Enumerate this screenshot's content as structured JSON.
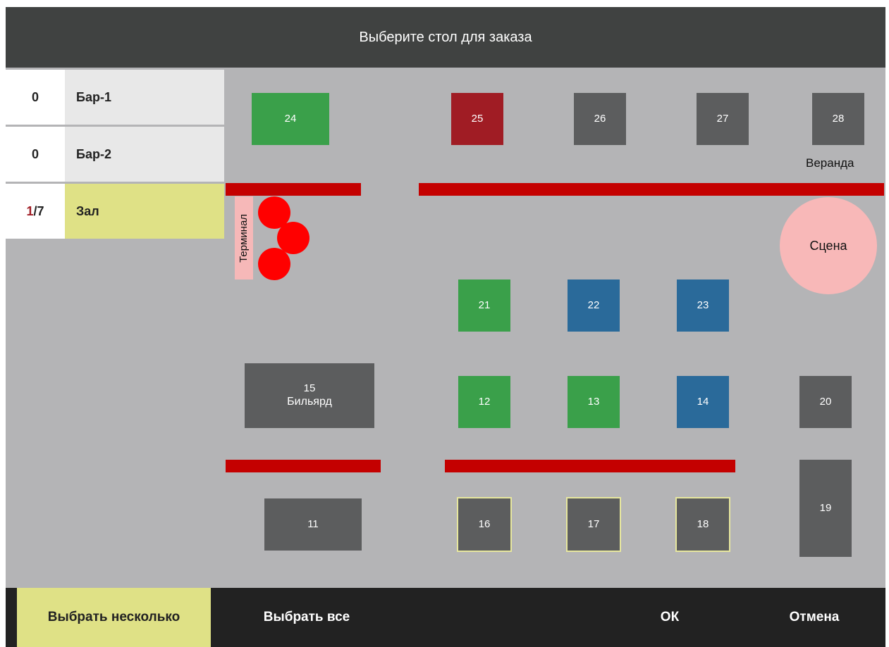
{
  "header": {
    "title": "Выберите стол для заказа"
  },
  "rooms": [
    {
      "count": "0",
      "name": "Бар-1"
    },
    {
      "count": "0",
      "name": "Бар-2"
    },
    {
      "count_highlight": "1",
      "count_rest": "/7",
      "name": "Зал"
    }
  ],
  "tables": {
    "t24": "24",
    "t25": "25",
    "t26": "26",
    "t27": "27",
    "t28": "28",
    "t21": "21",
    "t22": "22",
    "t23": "23",
    "t15": "15",
    "t15_sub": "Бильярд",
    "t12": "12",
    "t13": "13",
    "t14": "14",
    "t20": "20",
    "t11": "11",
    "t16": "16",
    "t17": "17",
    "t18": "18",
    "t19": "19"
  },
  "labels": {
    "veranda": "Веранда",
    "terminal": "Терминал",
    "stage": "Сцена"
  },
  "footer": {
    "select_multiple": "Выбрать несколько",
    "select_all": "Выбрать все",
    "ok": "ОК",
    "cancel": "Отмена"
  },
  "colors": {
    "free": "#5c5d5e",
    "occupied_green": "#3aa04a",
    "occupied_blue": "#2a6a9a",
    "busy_red": "#a01c24",
    "wall": "#c40000",
    "accent": "#dfe186"
  }
}
